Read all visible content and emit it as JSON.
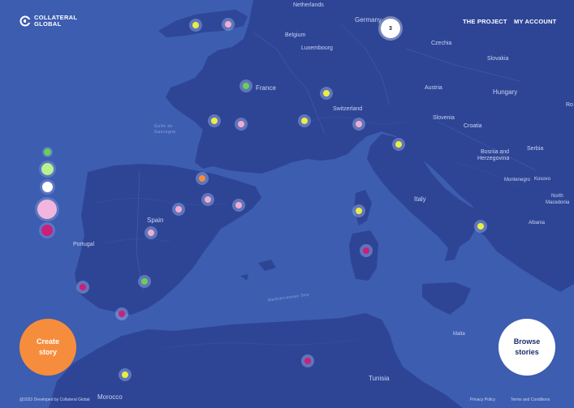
{
  "header": {
    "logo_line1": "COLLATERAL",
    "logo_line2": "GLOBAL",
    "nav": [
      "THE PROJECT",
      "MY ACCOUNT"
    ]
  },
  "map": {
    "countries": [
      "Netherlands",
      "Germany",
      "Belgium",
      "Luxembourg",
      "Czechia",
      "Slovakia",
      "France",
      "Austria",
      "Hungary",
      "Switzerland",
      "Slovenia",
      "Croatia",
      "Bosnia and",
      "Herzegovina",
      "Serbia",
      "Montenegro",
      "Kosovo",
      "North",
      "Macedonia",
      "Albania",
      "Spain",
      "Portugal",
      "Italy",
      "Tunisia",
      "Malta",
      "Morocco",
      "Ro"
    ],
    "seas": [
      "Mediterranean Sea",
      "Golfe de",
      "Gascogne"
    ],
    "cluster_count": "3",
    "colors": {
      "sea": "#3f5fb0",
      "land": "#2e4596",
      "yellow": "#e9ee45",
      "pink": "#efadd1",
      "green": "#67d057",
      "magenta": "#cc1f7c",
      "orange": "#f68d3d"
    }
  },
  "legend": {
    "swatches": [
      "green",
      "light-green",
      "white",
      "pink",
      "magenta"
    ]
  },
  "buttons": {
    "create_line1": "Create",
    "create_line2": "story",
    "browse_line1": "Browse",
    "browse_line2": "stories"
  },
  "footer": {
    "left": "@2023 Developed by Collateral Global",
    "privacy": "Privacy Policy",
    "terms": "Terms and Conditions"
  }
}
